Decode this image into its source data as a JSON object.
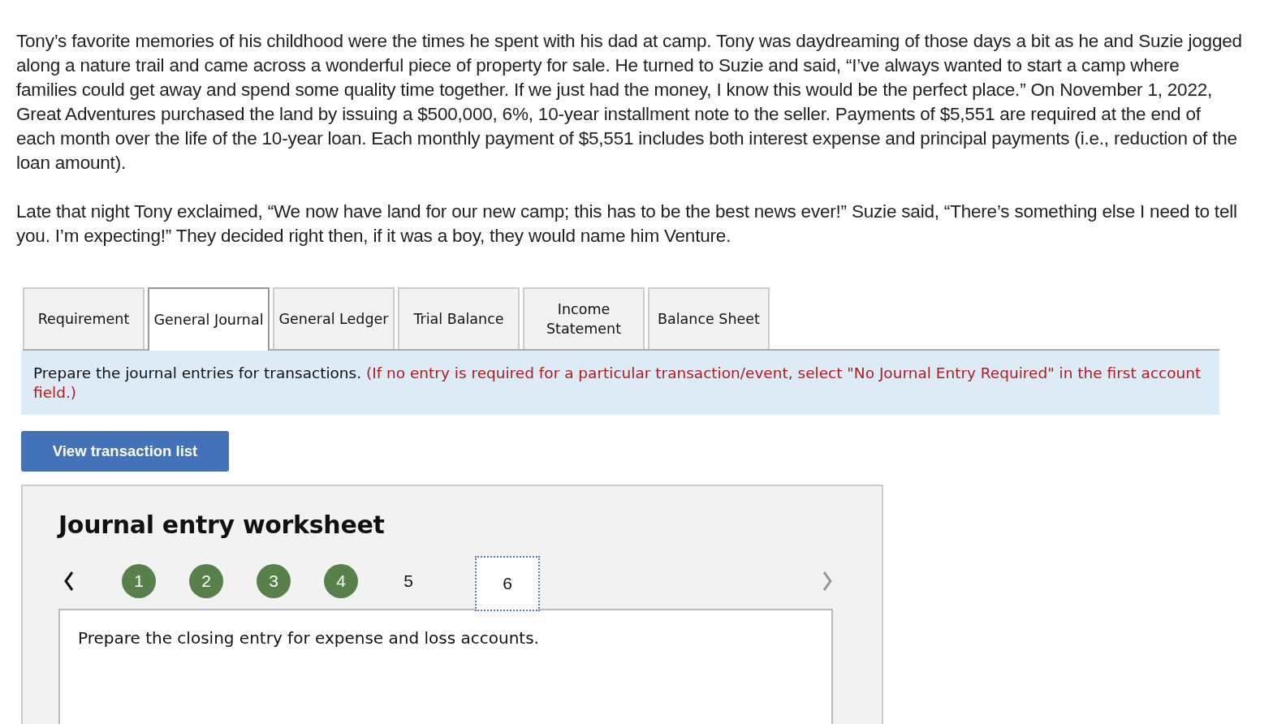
{
  "story": [
    "Tony’s favorite memories of his childhood were the times he spent with his dad at camp. Tony was daydreaming of those days a bit as he and Suzie jogged along a nature trail and came across a wonderful piece of property for sale. He turned to Suzie and said, “I’ve always wanted to start a camp where families could get away and spend some quality time together. If we just had the money, I know this would be the perfect place.” On November 1, 2022, Great Adventures purchased the land by issuing a $500,000, 6%, 10-year installment note to the seller. Payments of $5,551 are required at the end of each month over the life of the 10-year loan. Each monthly payment of $5,551 includes both interest expense and principal payments (i.e., reduction of the loan amount).",
    "Late that night Tony exclaimed, “We now have land for our new camp; this has to be the best news ever!” Suzie said, “There’s something else I need to tell you. I’m expecting!” They decided right then, if it was a boy, they would name him Venture."
  ],
  "tabs": [
    {
      "label": "Requirement",
      "selected": false
    },
    {
      "label": "General Journal",
      "selected": true
    },
    {
      "label": "General Ledger",
      "selected": false
    },
    {
      "label": "Trial Balance",
      "selected": false
    },
    {
      "label": "Income Statement",
      "selected": false
    },
    {
      "label": "Balance Sheet",
      "selected": false
    }
  ],
  "instruction": {
    "text": "Prepare the journal entries for transactions.",
    "note": "(If no entry is required for a particular transaction/event, select \"No Journal Entry Required\" in the first account field.)"
  },
  "view_button": "View transaction list",
  "worksheet": {
    "title": "Journal entry worksheet",
    "steps": [
      {
        "label": "1",
        "done": true,
        "selected": false
      },
      {
        "label": "2",
        "done": true,
        "selected": false
      },
      {
        "label": "3",
        "done": true,
        "selected": false
      },
      {
        "label": "4",
        "done": true,
        "selected": false
      },
      {
        "label": "5",
        "done": false,
        "selected": false
      },
      {
        "label": "6",
        "done": false,
        "selected": true
      }
    ],
    "prompt": "Prepare the closing entry for expense and loss accounts."
  }
}
